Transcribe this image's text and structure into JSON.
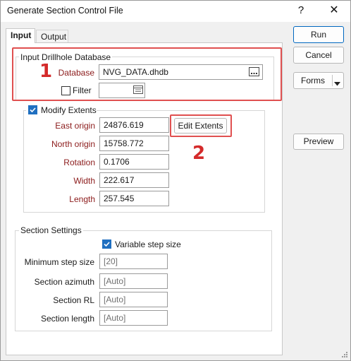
{
  "window": {
    "title": "Generate Section Control File",
    "help_label": "?",
    "close_label": "✕"
  },
  "tabs": [
    {
      "label": "Input"
    },
    {
      "label": "Output"
    }
  ],
  "input_group": {
    "title": "Input Drillhole Database",
    "database_label": "Database",
    "database_value": "NVG_DATA.dhdb",
    "filter_label": "Filter",
    "filter_value": ""
  },
  "extents_group": {
    "title": "Modify Extents",
    "edit_button": "Edit Extents",
    "fields": [
      {
        "label": "East origin",
        "value": "24876.619"
      },
      {
        "label": "North origin",
        "value": "15758.772"
      },
      {
        "label": "Rotation",
        "value": "0.1706"
      },
      {
        "label": "Width",
        "value": "222.617"
      },
      {
        "label": "Length",
        "value": "257.545"
      }
    ]
  },
  "section_group": {
    "title": "Section Settings",
    "variable_label": "Variable step size",
    "fields": [
      {
        "label": "Minimum step size",
        "value": "[20]"
      },
      {
        "label": "Section azimuth",
        "value": "[Auto]"
      },
      {
        "label": "Section RL",
        "value": "[Auto]"
      },
      {
        "label": "Section length",
        "value": "[Auto]"
      }
    ]
  },
  "side_buttons": {
    "run": "Run",
    "cancel": "Cancel",
    "forms": "Forms",
    "preview": "Preview"
  },
  "annotations": {
    "marker_1": "1",
    "marker_2": "2"
  },
  "colors": {
    "highlight_red": "#e05050",
    "required_label": "#8b1a1a",
    "accent_blue": "#1f6fc0"
  }
}
